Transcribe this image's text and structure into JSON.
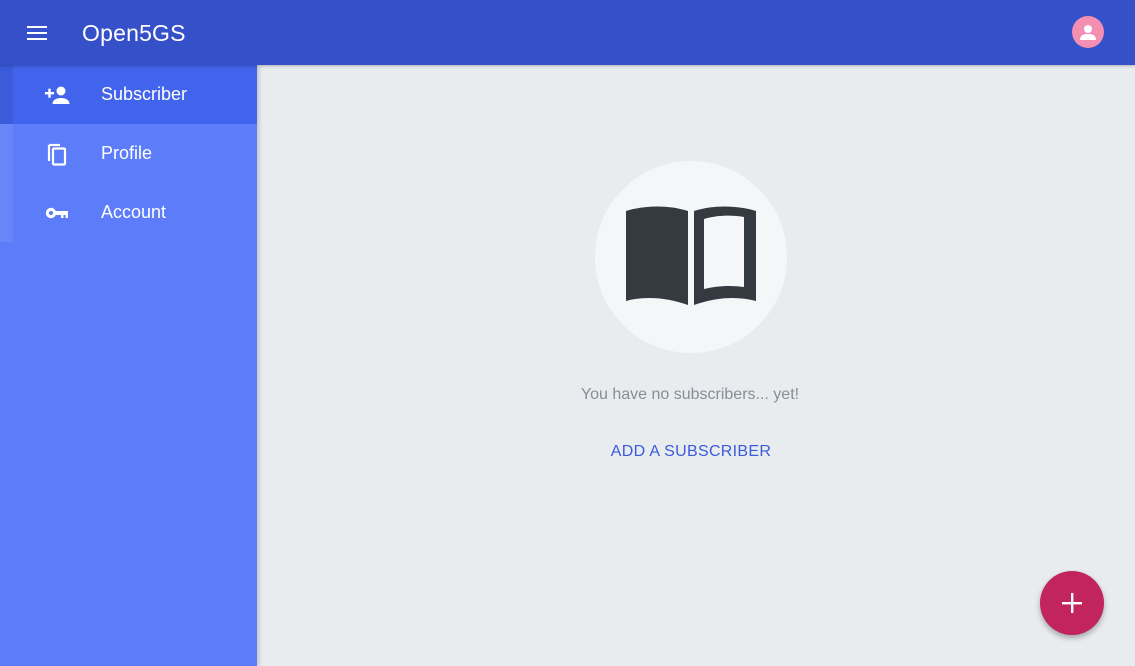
{
  "header": {
    "title": "Open5GS",
    "menu_icon": "hamburger-menu-icon",
    "avatar_icon": "user-avatar-icon"
  },
  "sidebar": {
    "items": [
      {
        "label": "Subscriber",
        "icon": "person-add-icon",
        "active": true
      },
      {
        "label": "Profile",
        "icon": "copy-icon",
        "active": false
      },
      {
        "label": "Account",
        "icon": "key-icon",
        "active": false
      }
    ]
  },
  "main": {
    "empty_icon": "open-book-icon",
    "empty_message": "You have no subscribers... yet!",
    "add_link_label": "ADD A SUBSCRIBER"
  },
  "fab": {
    "icon": "plus-icon"
  },
  "colors": {
    "header": "#3650c9",
    "sidebar": "#5c7cfa",
    "sidebar_active": "#4263eb",
    "content_bg": "#e9ecef",
    "accent_link": "#3b5bdb",
    "fab": "#c2255c",
    "avatar": "#f48fb1"
  }
}
